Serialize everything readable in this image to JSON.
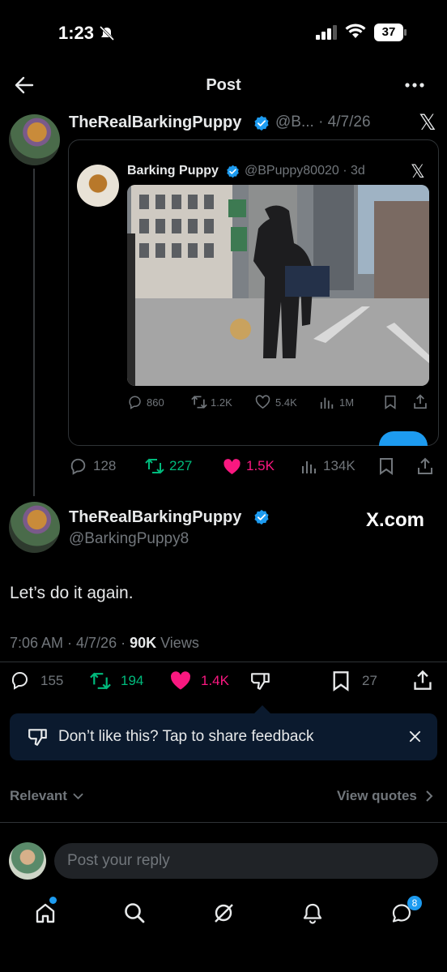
{
  "status_bar": {
    "time": "1:23",
    "battery": "37"
  },
  "header": {
    "title": "Post"
  },
  "parent_post": {
    "display_name": "TheRealBarkingPuppy",
    "handle_date": "@B... · 4/7/26",
    "quoted": {
      "display_name": "Barking Puppy",
      "handle": "@BPuppy80020",
      "age": "· 3d",
      "stats": {
        "replies": "860",
        "reposts": "1.2K",
        "likes": "5.4K",
        "views": "1M"
      }
    },
    "stats": {
      "replies": "128",
      "reposts": "227",
      "likes": "1.5K",
      "views": "134K"
    }
  },
  "main_post": {
    "display_name": "TheRealBarkingPuppy",
    "handle": "@BarkingPuppy8",
    "watermark": "X.com",
    "text": "Let’s do it again.",
    "timestamp": "7:06 AM · 4/7/26 · ",
    "views_count": "90K",
    "views_label": "Views",
    "stats": {
      "replies": "155",
      "reposts": "194",
      "likes": "1.4K",
      "bookmarks": "27"
    }
  },
  "feedback": {
    "text": "Don’t like this? Tap to share feedback"
  },
  "sort": {
    "label": "Relevant",
    "view_quotes": "View quotes"
  },
  "reply": {
    "placeholder": "Post your reply"
  },
  "nav": {
    "messages_badge": "8"
  },
  "colors": {
    "accent": "#1d9bf0",
    "repost": "#00ba7c",
    "like": "#f91880",
    "background": "#000000"
  },
  "icons": [
    "back-arrow-icon",
    "more-icon",
    "x-logo-icon",
    "verified-icon",
    "reply-icon",
    "repost-icon",
    "heart-icon",
    "views-icon",
    "bookmark-icon",
    "share-icon",
    "dislike-icon",
    "close-icon",
    "chevron-down-icon",
    "chevron-right-icon",
    "home-icon",
    "search-icon",
    "grok-icon",
    "bell-icon",
    "messages-icon"
  ]
}
